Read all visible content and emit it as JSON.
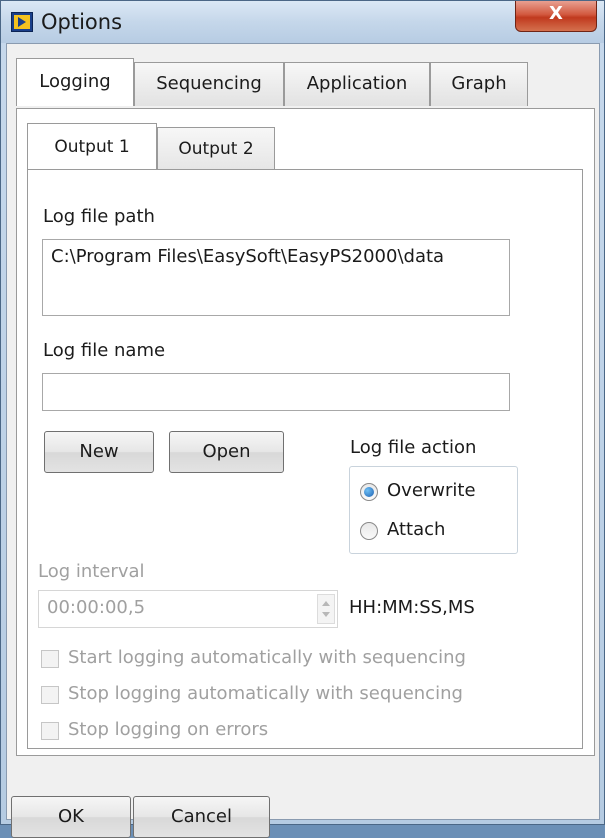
{
  "window": {
    "title": "Options",
    "close_glyph": "X"
  },
  "tabs": [
    {
      "label": "Logging",
      "selected": true
    },
    {
      "label": "Sequencing"
    },
    {
      "label": "Application"
    },
    {
      "label": "Graph"
    }
  ],
  "output_tabs": [
    {
      "label": "Output 1",
      "selected": true
    },
    {
      "label": "Output 2"
    }
  ],
  "logging": {
    "path_label": "Log file path",
    "path_value": "C:\\Program Files\\EasySoft\\EasyPS2000\\data",
    "name_label": "Log file name",
    "name_value": "",
    "new_button": "New",
    "open_button": "Open",
    "action_label": "Log file action",
    "action_options": [
      {
        "label": "Overwrite",
        "checked": true
      },
      {
        "label": "Attach",
        "checked": false
      }
    ],
    "interval_label": "Log interval",
    "interval_value": "00:00:00,5",
    "interval_format": "HH:MM:SS,MS",
    "options": [
      {
        "label": "Start logging automatically with sequencing",
        "checked": false,
        "enabled": false
      },
      {
        "label": "Stop logging automatically with sequencing",
        "checked": false,
        "enabled": false
      },
      {
        "label": "Stop logging on errors",
        "checked": false,
        "enabled": false
      }
    ]
  },
  "footer": {
    "ok_button": "OK",
    "cancel_button": "Cancel"
  },
  "colors": {
    "title_bar": "#c5d7ea",
    "close_button": "#c0391e",
    "radio_selected": "#1d5fb0"
  }
}
